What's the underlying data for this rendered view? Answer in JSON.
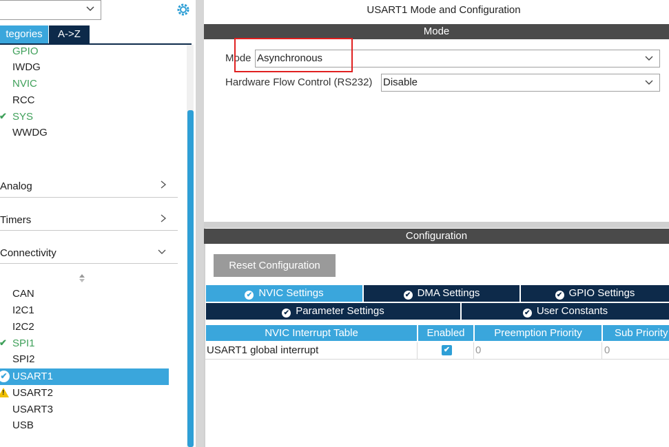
{
  "left_panel": {
    "tabs": [
      "tegories",
      "A->Z"
    ],
    "system_items": [
      {
        "label": "GPIO",
        "state": "green"
      },
      {
        "label": "IWDG",
        "state": "normal"
      },
      {
        "label": "NVIC",
        "state": "green"
      },
      {
        "label": "RCC",
        "state": "normal"
      },
      {
        "label": "SYS",
        "state": "checked"
      },
      {
        "label": "WWDG",
        "state": "normal"
      }
    ],
    "categories": [
      {
        "label": "Analog",
        "expanded": false
      },
      {
        "label": "Timers",
        "expanded": false
      },
      {
        "label": "Connectivity",
        "expanded": true
      }
    ],
    "connectivity_items": [
      {
        "label": "CAN",
        "state": "normal"
      },
      {
        "label": "I2C1",
        "state": "normal"
      },
      {
        "label": "I2C2",
        "state": "normal"
      },
      {
        "label": "SPI1",
        "state": "checked"
      },
      {
        "label": "SPI2",
        "state": "normal"
      },
      {
        "label": "USART1",
        "state": "selected"
      },
      {
        "label": "USART2",
        "state": "warning"
      },
      {
        "label": "USART3",
        "state": "normal"
      },
      {
        "label": "USB",
        "state": "normal"
      }
    ],
    "icons": {
      "dropdown": "chevron-down-icon",
      "settings": "gear-icon",
      "sort": "sort-icon"
    }
  },
  "right_panel": {
    "title": "USART1 Mode and Configuration",
    "mode_section_title": "Mode",
    "mode_label": "Mode",
    "mode_value": "Asynchronous",
    "flow_label": "Hardware Flow Control (RS232)",
    "flow_value": "Disable",
    "config_section_title": "Configuration",
    "reset_button": "Reset Configuration",
    "tabs_row1": [
      "NVIC Settings",
      "DMA Settings",
      "GPIO Settings"
    ],
    "tabs_row2": [
      "Parameter Settings",
      "User Constants"
    ],
    "active_tab": "NVIC Settings",
    "table": {
      "headers": [
        "NVIC Interrupt Table",
        "Enabled",
        "Preemption Priority",
        "Sub Priority"
      ],
      "rows": [
        {
          "name": "USART1 global interrupt",
          "enabled": true,
          "preemption": "0",
          "sub": "0"
        }
      ]
    }
  },
  "colors": {
    "accent": "#3aa6dc",
    "dark_nav": "#0d2a4a",
    "ok_green": "#3fa05a",
    "warning": "#f0c000",
    "highlight": "#e02020"
  }
}
